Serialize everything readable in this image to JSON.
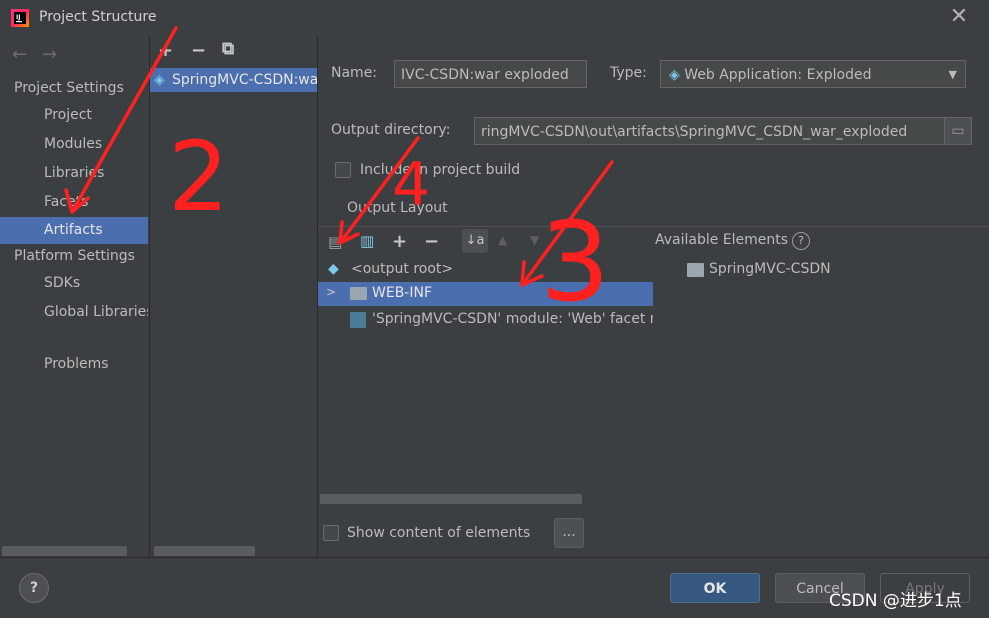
{
  "window": {
    "title": "Project Structure",
    "close_label": "✕"
  },
  "nav": {
    "back": "←",
    "forward": "→"
  },
  "sidebar": {
    "project_settings": "Project Settings",
    "platform_settings": "Platform Settings",
    "items": [
      {
        "label": "Project"
      },
      {
        "label": "Modules"
      },
      {
        "label": "Libraries"
      },
      {
        "label": "Facets"
      },
      {
        "label": "Artifacts",
        "selected": true
      },
      {
        "label": "SDKs"
      },
      {
        "label": "Global Libraries"
      },
      {
        "label": "Problems"
      }
    ]
  },
  "artifacts_list": {
    "toolbar": {
      "add": "+",
      "remove": "−",
      "copy": "⧉"
    },
    "item": "SpringMVC-CSDN:war exploded"
  },
  "form": {
    "name_label": "Name:",
    "name_value": "IVC-CSDN:war exploded",
    "type_label": "Type:",
    "type_value": "Web Application: Exploded",
    "output_dir_label": "Output directory:",
    "output_dir_value": "ringMVC-CSDN\\out\\artifacts\\SpringMVC_CSDN_war_exploded",
    "include_label": "Include in project build",
    "output_layout_label": "Output Layout"
  },
  "layout_tree": {
    "root": "<output root>",
    "web_inf": "WEB-INF",
    "facet": "'SpringMVC-CSDN' module: 'Web' facet resources"
  },
  "available": {
    "label": "Available Elements",
    "help": "?",
    "item": "SpringMVC-CSDN"
  },
  "show_content_label": "Show content of elements",
  "ellipsis_label": "...",
  "buttons": {
    "ok": "OK",
    "cancel": "Cancel",
    "apply": "Apply",
    "help": "?"
  },
  "annotations": {
    "n2": "2",
    "n3": "3",
    "n4": "4"
  },
  "watermark": "CSDN @进步1点",
  "colors": {
    "background": "#3c3f41",
    "selection": "#4b6eaf",
    "ok_button": "#365880",
    "annotation": "#ff2020"
  }
}
